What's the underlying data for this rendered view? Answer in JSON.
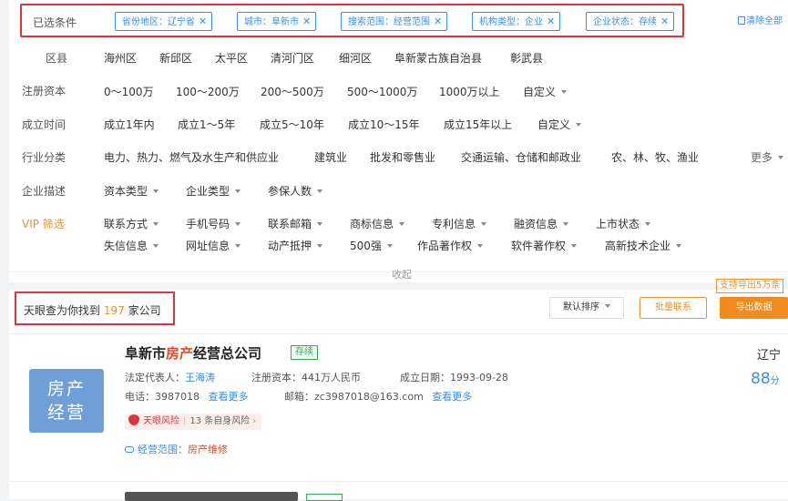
{
  "selected": {
    "label": "已选条件",
    "tags": [
      "省份地区：辽宁省",
      "城市：阜新市",
      "搜索范围：经营范围",
      "机构类型：企业",
      "企业状态：存续"
    ],
    "clear_label": "清除全部"
  },
  "filters": {
    "district": {
      "label": "区县",
      "options": [
        "海州区",
        "新邱区",
        "太平区",
        "清河门区",
        "细河区",
        "阜新蒙古族自治县",
        "彰武县"
      ]
    },
    "capital": {
      "label": "注册资本",
      "options": [
        "0～100万",
        "100～200万",
        "200～500万",
        "500～1000万",
        "1000万以上"
      ],
      "custom": "自定义"
    },
    "established": {
      "label": "成立时间",
      "options": [
        "成立1年内",
        "成立1～5年",
        "成立5～10年",
        "成立10～15年",
        "成立15年以上"
      ],
      "custom": "自定义"
    },
    "industry": {
      "label": "行业分类",
      "options": [
        "电力、热力、燃气及水生产和供应业",
        "建筑业",
        "批发和零售业",
        "交通运输、仓储和邮政业",
        "农、林、牧、渔业"
      ],
      "more": "更多"
    },
    "description": {
      "label": "企业描述",
      "dropdowns": [
        "资本类型",
        "企业类型",
        "参保人数"
      ]
    },
    "vip": {
      "label": "VIP 筛选",
      "row1": [
        "联系方式",
        "手机号码",
        "联系邮箱",
        "商标信息",
        "专利信息",
        "融资信息",
        "上市状态"
      ],
      "row2": [
        "失信信息",
        "网址信息",
        "动产抵押",
        "500强",
        "作品著作权",
        "软件著作权",
        "高新技术企业"
      ]
    },
    "collapse_label": "收起"
  },
  "results": {
    "prefix": "天眼查为你找到",
    "count": "197",
    "suffix": "家公司",
    "sort_label": "默认排序",
    "batch_contact_label": "批量联系",
    "export_label": "导出数据",
    "export_tip": "支持导出5万条"
  },
  "company": {
    "logo_line1": "房产",
    "logo_line2": "经营",
    "name_pre": "阜新市",
    "name_hl": "房产",
    "name_post": "经营总公司",
    "status": "存续",
    "legal_rep_label": "法定代表人：",
    "legal_rep": "王海涛",
    "capital_label": "注册资本：",
    "capital": "441万人民币",
    "date_label": "成立日期：",
    "date": "1993-09-28",
    "phone_label": "电话：",
    "phone": "3987018",
    "more1": "查看更多",
    "email_label": "邮箱：",
    "email": "zc3987018@163.com",
    "more2": "查看更多",
    "risk_brand": "天眼风险",
    "risk_text": "13 条自身风险",
    "scope_label": "经营范围：",
    "scope_hl": "房产",
    "scope_post": "维修",
    "region": "辽宁",
    "score": "88",
    "score_unit": "分"
  }
}
